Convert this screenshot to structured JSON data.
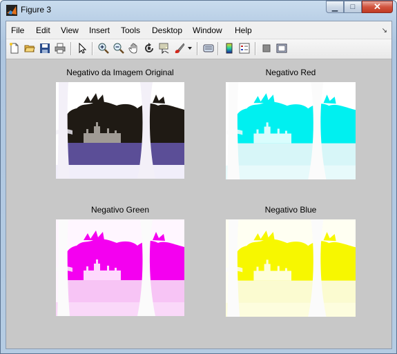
{
  "window": {
    "title": "Figure 3"
  },
  "menubar": {
    "items": [
      "File",
      "Edit",
      "View",
      "Insert",
      "Tools",
      "Desktop",
      "Window",
      "Help"
    ]
  },
  "toolbar": {
    "icons": [
      "new-figure-icon",
      "open-file-icon",
      "save-icon",
      "print-icon",
      "edit-plot-icon",
      "zoom-in-icon",
      "zoom-out-icon",
      "pan-icon",
      "rotate-3d-icon",
      "data-cursor-icon",
      "brush-icon",
      "link-plot-icon",
      "insert-colorbar-icon",
      "insert-legend-icon",
      "hide-plot-tools-icon",
      "show-plot-tools-icon"
    ]
  },
  "axes": [
    {
      "title": "Negativo da Imagem Original",
      "variant": "original",
      "sky": "#ffffff",
      "foliage": "#1f1a14",
      "water": "#5b4e97"
    },
    {
      "title": "Negativo Red",
      "variant": "red",
      "sky": "#ffffff",
      "foliage": "#00f0f0",
      "water": "#d7f6f8"
    },
    {
      "title": "Negativo Green",
      "variant": "green",
      "sky": "#fff6ff",
      "foliage": "#f400f0",
      "water": "#f7c4f5"
    },
    {
      "title": "Negativo Blue",
      "variant": "blue",
      "sky": "#fffff2",
      "foliage": "#f7f700",
      "water": "#fbfbd0"
    }
  ]
}
